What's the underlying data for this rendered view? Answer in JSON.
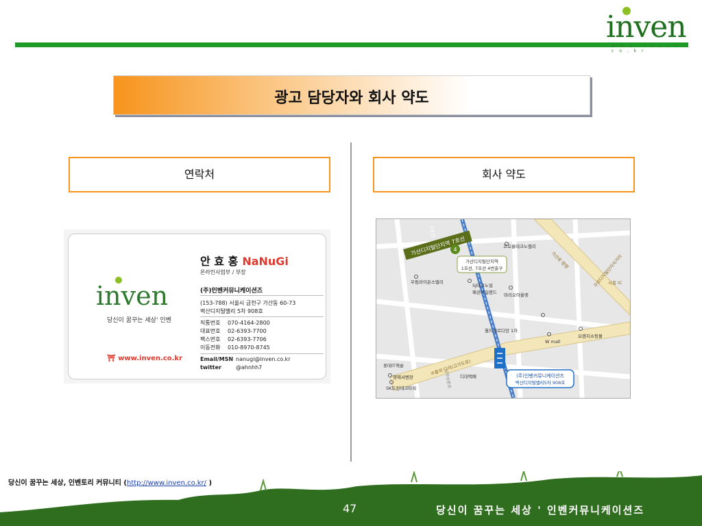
{
  "logo": {
    "text": "inven",
    "sub": "w w w . i n v e n . c o . k r"
  },
  "title": "광고 담당자와 회사 약도",
  "sections": {
    "contact": "연락처",
    "map": "회사 약도"
  },
  "card": {
    "name": "안 효 홍",
    "nickname": "NaNuGi",
    "role": "온라인사업부 / 부장",
    "company": "(주)인벤커뮤니케이션즈",
    "address1": "(153-788) 서울시 금천구 가산동 60-73",
    "address2": "벽산디지털밸리 5차 908호",
    "phones": [
      {
        "label": "직통번호",
        "value": "070-4164-2800"
      },
      {
        "label": "대표번호",
        "value": "02-6393-7700"
      },
      {
        "label": "팩스번호",
        "value": "02-6393-7706"
      },
      {
        "label": "이동전화",
        "value": "010-8970-8745"
      }
    ],
    "email_label": "Email/MSN",
    "email": "nanugi@inven.co.kr",
    "twitter_label": "twitter",
    "twitter": "@ahnhh7",
    "logo_text": "inven",
    "slogan": "당신이 꿈꾸는 세상' 인벤",
    "site": "www.inven.co.kr"
  },
  "map": {
    "station_sign": "가산디지털단지역 7호선",
    "station_num": "4",
    "station_callout_1": "가산디지털단지역",
    "station_callout_2": "1호선, 7호선 4번출구",
    "line1_label": "1호선",
    "road_right": "구로디지털단지사거리",
    "road_right2": "시흥 IC",
    "road_bottom": "수출의 다리(고가도로)",
    "road_vert": "가산로 방향",
    "road_vert2": "남부순환로",
    "places": [
      "코오롱테크노밸리",
      "우림라이온스밸리",
      "SJ테크노빌",
      "패션아일랜드",
      "마리오아울렛",
      "월드메르디앙 1차",
      "W mall",
      "오렌지쇼핑몰",
      "롯데IT캐슬",
      "영에서벤장",
      "SK트윈테크타워",
      "디대택배"
    ],
    "company_callout_1": "(주)인벤커뮤니케이션즈",
    "company_callout_2": "벽산디지털밸리5차 908호"
  },
  "footer": {
    "note_prefix": "당신이 꿈꾸는 세상, 인벤토리 커뮤니티 (",
    "link": "http://www.inven.co.kr/",
    "note_suffix": " )",
    "page": "47",
    "slogan": "당신이 꿈꾸는 세상 ' 인벤커뮤니케이션즈"
  },
  "colors": {
    "green": "#1e9a26",
    "orange": "#f7941d",
    "grass": "#2f6e1e"
  }
}
